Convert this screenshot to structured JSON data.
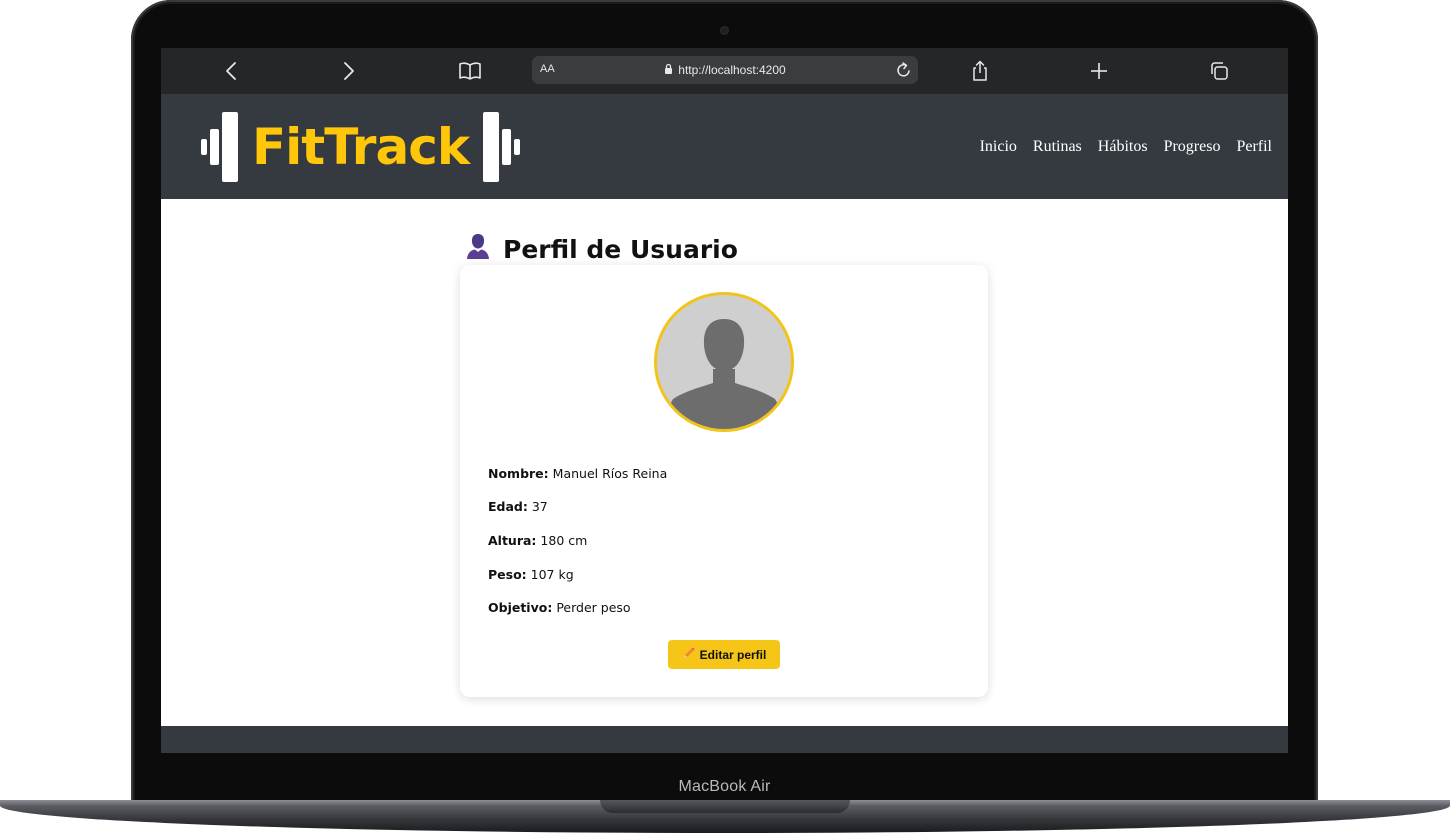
{
  "device": {
    "label": "MacBook Air"
  },
  "browser": {
    "text_size_label": "AA",
    "url": "http://localhost:4200",
    "icons": [
      "chevron-left-icon",
      "chevron-right-icon",
      "book-icon",
      "lock-icon",
      "reload-icon",
      "share-icon",
      "plus-icon",
      "tabs-icon"
    ]
  },
  "header": {
    "logo_text": "FitTrack",
    "nav": [
      {
        "label": "Inicio"
      },
      {
        "label": "Rutinas"
      },
      {
        "label": "Hábitos"
      },
      {
        "label": "Progreso"
      },
      {
        "label": "Perfil"
      }
    ],
    "colors": {
      "background": "#343a40",
      "logo": "#ffc60a"
    }
  },
  "profile": {
    "title": "Perfil de Usuario",
    "fields": [
      {
        "label": "Nombre:",
        "value": "Manuel Ríos Reina"
      },
      {
        "label": "Edad:",
        "value": "37"
      },
      {
        "label": "Altura:",
        "value": "180 cm"
      },
      {
        "label": "Peso:",
        "value": "107 kg"
      },
      {
        "label": "Objetivo:",
        "value": "Perder peso"
      }
    ],
    "edit_button": "Editar perfil",
    "colors": {
      "accent": "#f5c518",
      "avatar_border": "#f3c418"
    }
  }
}
